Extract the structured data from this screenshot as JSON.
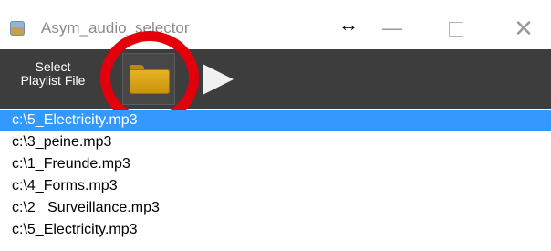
{
  "window": {
    "title": "Asym_audio_selector",
    "icons": [
      "app-icon",
      "resize-arrows-icon",
      "minimize-icon",
      "maximize-icon",
      "close-icon"
    ]
  },
  "toolbar": {
    "select_label": "Select\nPlaylist File",
    "buttons": [
      "folder-icon",
      "play-icon"
    ]
  },
  "annotation": {
    "color": "#e3000b"
  },
  "colors": {
    "toolbar_bg": "#3d3d3d",
    "selection_bg": "#3399ff",
    "folder": "#e8b424"
  },
  "playlist": {
    "items": [
      "c:\\5_Electricity.mp3",
      "c:\\3_peine.mp3",
      "c:\\1_Freunde.mp3",
      "c:\\4_Forms.mp3",
      "c:\\2_ Surveillance.mp3",
      "c:\\5_Electricity.mp3"
    ],
    "selected_index": 0
  }
}
